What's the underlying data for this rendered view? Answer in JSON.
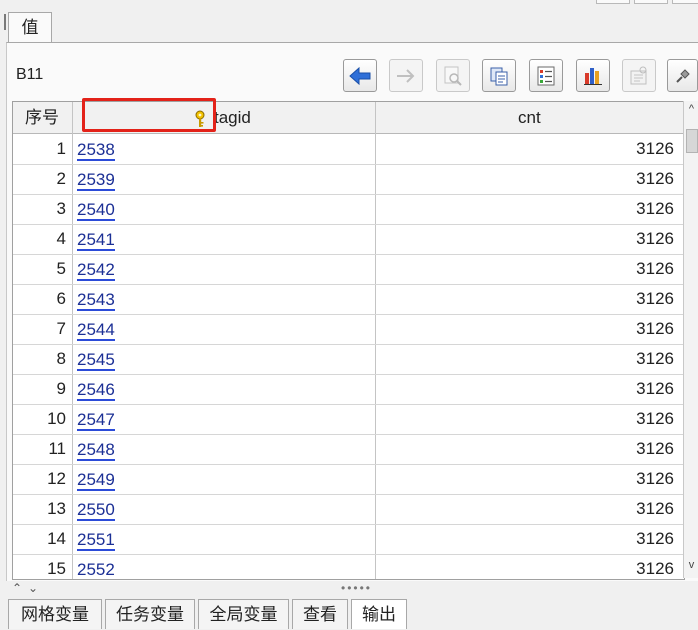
{
  "tab_value": "值",
  "cell_name": "B11",
  "toolbar": {
    "buttons": [
      {
        "name": "back-button",
        "icon": "arrow-left-icon",
        "enabled": true
      },
      {
        "name": "forward-button",
        "icon": "arrow-right-icon",
        "enabled": false
      },
      {
        "name": "inspect-button",
        "icon": "magnifier-icon",
        "enabled": false
      },
      {
        "name": "copy-button",
        "icon": "copy-icon",
        "enabled": true
      },
      {
        "name": "list-button",
        "icon": "list-icon",
        "enabled": true
      },
      {
        "name": "chart-button",
        "icon": "bar-chart-icon",
        "enabled": true
      },
      {
        "name": "properties-button",
        "icon": "properties-icon",
        "enabled": false
      },
      {
        "name": "pin-button",
        "icon": "pin-icon",
        "enabled": true
      }
    ]
  },
  "table": {
    "columns": [
      "序号",
      "tagid",
      "cnt"
    ],
    "key_column": "tagid",
    "rows": [
      {
        "idx": "1",
        "tagid": "2538",
        "cnt": "3126"
      },
      {
        "idx": "2",
        "tagid": "2539",
        "cnt": "3126"
      },
      {
        "idx": "3",
        "tagid": "2540",
        "cnt": "3126"
      },
      {
        "idx": "4",
        "tagid": "2541",
        "cnt": "3126"
      },
      {
        "idx": "5",
        "tagid": "2542",
        "cnt": "3126"
      },
      {
        "idx": "6",
        "tagid": "2543",
        "cnt": "3126"
      },
      {
        "idx": "7",
        "tagid": "2544",
        "cnt": "3126"
      },
      {
        "idx": "8",
        "tagid": "2545",
        "cnt": "3126"
      },
      {
        "idx": "9",
        "tagid": "2546",
        "cnt": "3126"
      },
      {
        "idx": "10",
        "tagid": "2547",
        "cnt": "3126"
      },
      {
        "idx": "11",
        "tagid": "2548",
        "cnt": "3126"
      },
      {
        "idx": "12",
        "tagid": "2549",
        "cnt": "3126"
      },
      {
        "idx": "13",
        "tagid": "2550",
        "cnt": "3126"
      },
      {
        "idx": "14",
        "tagid": "2551",
        "cnt": "3126"
      },
      {
        "idx": "15",
        "tagid": "2552",
        "cnt": "3126"
      }
    ]
  },
  "bottom_tabs": [
    "网格变量",
    "任务变量",
    "全局变量",
    "查看",
    "输出"
  ],
  "colors": {
    "highlight": "#e32219",
    "link": "#1b2f95",
    "key_icon": "#e0b400"
  }
}
